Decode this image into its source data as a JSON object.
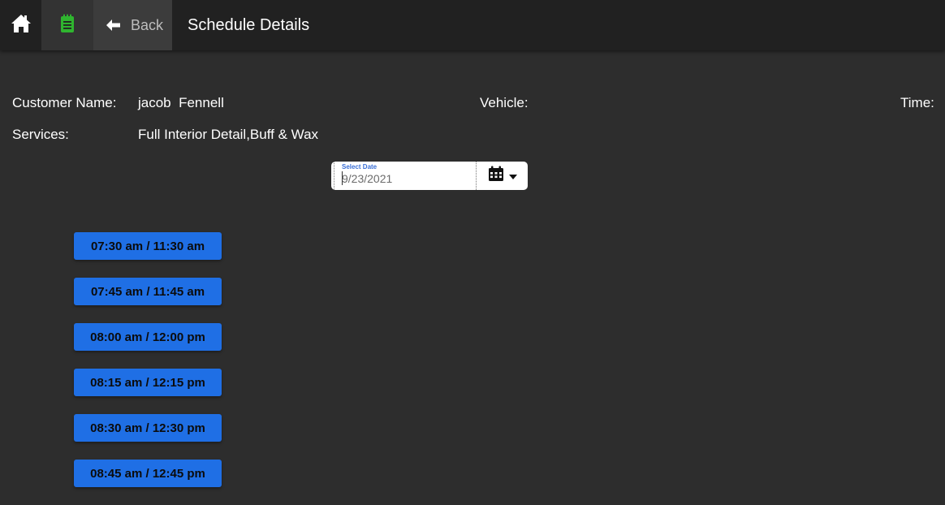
{
  "header": {
    "home_icon": "home-icon",
    "notes_icon": "notepad-icon",
    "back_icon": "arrow-left-icon",
    "back_label": "Back",
    "title": "Schedule Details",
    "accent_green": "#2fb52f"
  },
  "details": {
    "customer_label": "Customer Name:",
    "customer_value": "jacob  Fennell",
    "vehicle_label": "Vehicle:",
    "time_label": "Time:",
    "services_label": "Services:",
    "services_value": "Full Interior Detail,Buff & Wax"
  },
  "date_picker": {
    "caption": "Select Date",
    "value": "9/23/2021",
    "calendar_icon": "calendar-icon",
    "dropdown_icon": "caret-down-icon",
    "caption_color": "#3a6fd6"
  },
  "time_slots": [
    "07:30 am / 11:30 am",
    "07:45 am / 11:45 am",
    "08:00 am / 12:00 pm",
    "08:15 am / 12:15 pm",
    "08:30 am / 12:30 pm",
    "08:45 am / 12:45 pm"
  ],
  "colors": {
    "background": "#2d2d2d",
    "topbar": "#212121",
    "slot_button": "#1f6fe5"
  }
}
